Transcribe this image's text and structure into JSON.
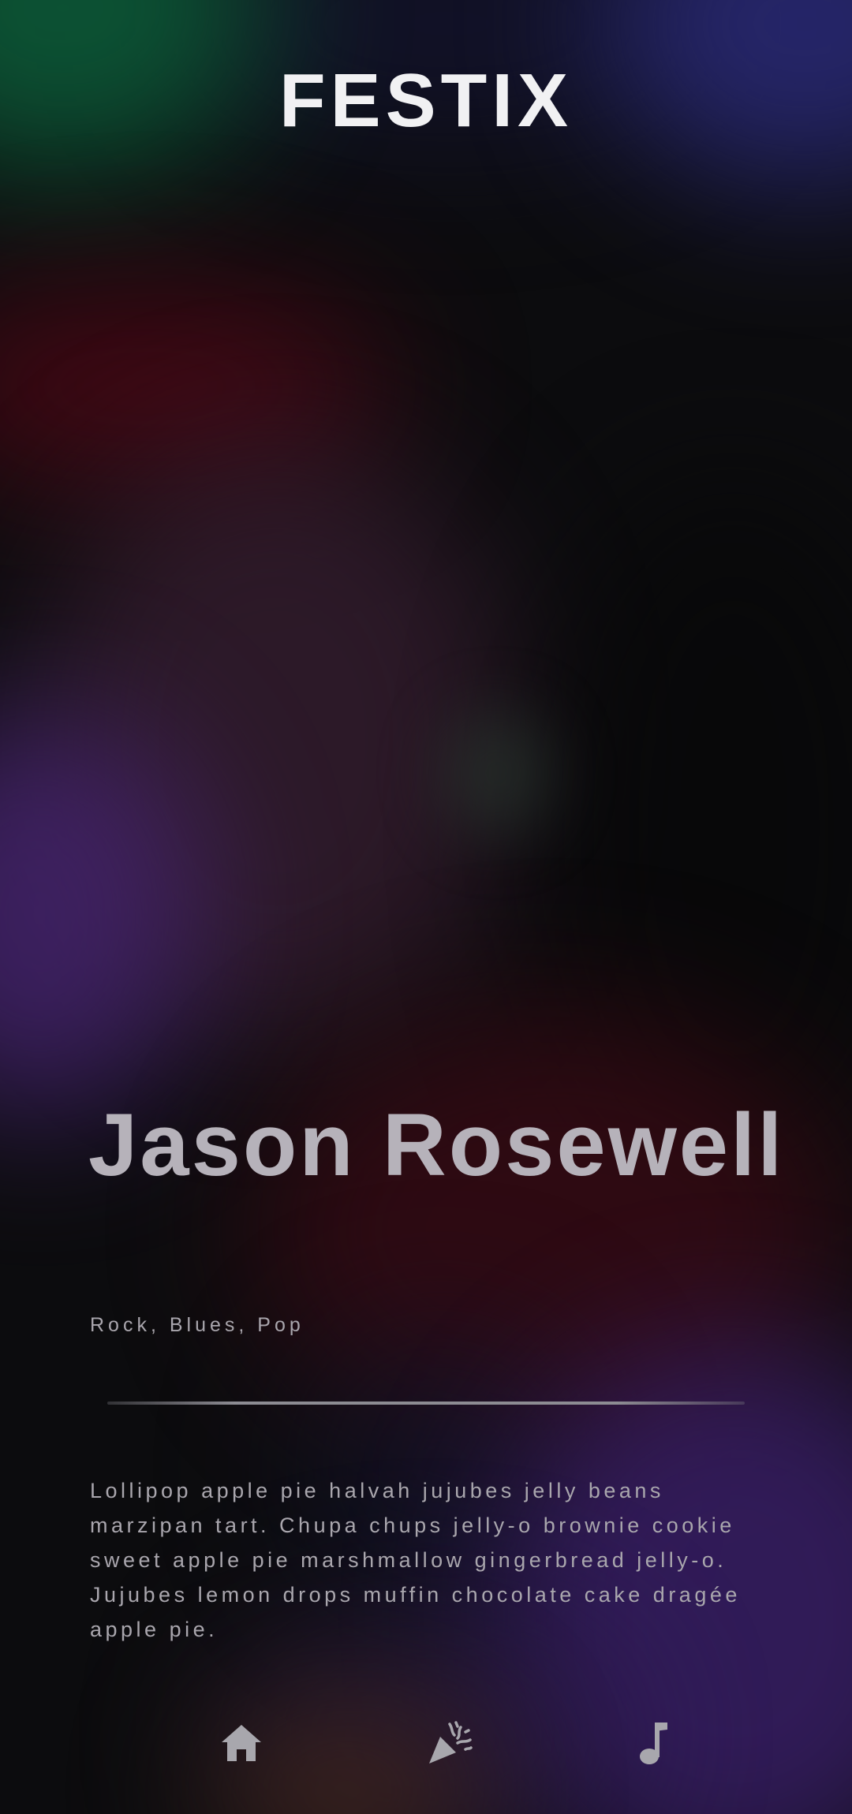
{
  "app": {
    "logo": "FESTIX"
  },
  "artist": {
    "name": "Jason Rosewell",
    "genres": "Rock, Blues, Pop",
    "bio": "Lollipop apple pie halvah jujubes jelly beans marzipan tart. Chupa chups jelly-o brownie cookie sweet apple pie marshmallow gingerbread jelly-o. Jujubes lemon drops muffin chocolate cake dragée apple pie."
  },
  "nav": {
    "items": [
      {
        "icon": "home-icon"
      },
      {
        "icon": "party-popper-icon"
      },
      {
        "icon": "music-note-icon"
      }
    ]
  },
  "colors": {
    "logo": "#f1f1f3",
    "name": "#b6b2ba",
    "text": "#a9a6ad",
    "icon": "#a8a7ad",
    "background": "#0b0b0d"
  }
}
